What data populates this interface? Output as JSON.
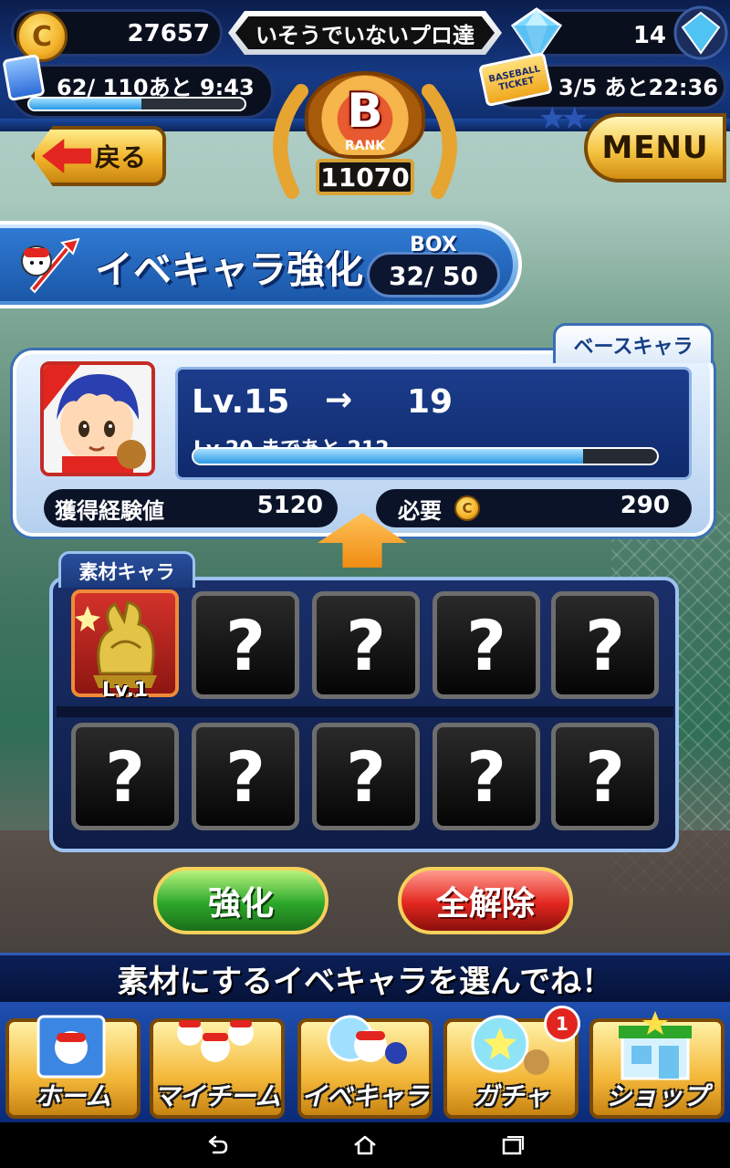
{
  "header": {
    "coins": "27657",
    "player_title": "いそうでいないプロ達",
    "gems": "14",
    "stamina": "62/ 110あと  9:43",
    "stamina_fraction": 0.52,
    "tickets": "3/5  あと22:36",
    "ticket_icon_text_1": "BASEBALL",
    "ticket_icon_text_2": "TICKET",
    "rank_letter": "B",
    "rank_word": "RANK",
    "rank_score": "11070",
    "back_label": "戻る",
    "menu_label": "MENU"
  },
  "section": {
    "title": "イベキャラ強化",
    "box_label": "BOX",
    "box_value": "32/ 50"
  },
  "base": {
    "tag": "ベースキャラ",
    "level_from": "Lv.15",
    "arrow": "→",
    "level_to": "19",
    "next_level_text": "Lv.20   まであと 212",
    "exp_fraction": 0.84,
    "gained_exp_label": "獲得経験値",
    "gained_exp_value": "5120",
    "cost_label": "必要",
    "cost_value": "290",
    "coin_symbol": "C"
  },
  "materials": {
    "tag": "素材キャラ",
    "filled_level": "Lv.1",
    "empty_symbol": "?"
  },
  "actions": {
    "enhance_label": "強化",
    "clear_label": "全解除"
  },
  "instruction": "素材にするイベキャラを選んでね！",
  "nav": {
    "home": "ホーム",
    "team": "マイチーム",
    "event_chara": "イベキャラ",
    "gacha": "ガチャ",
    "gacha_badge": "1",
    "shop": "ショップ"
  },
  "colors": {
    "accent_gold": "#f4b83a",
    "accent_blue": "#1b57a8",
    "enhance_green": "#2ca72a",
    "clear_red": "#e2261f"
  }
}
